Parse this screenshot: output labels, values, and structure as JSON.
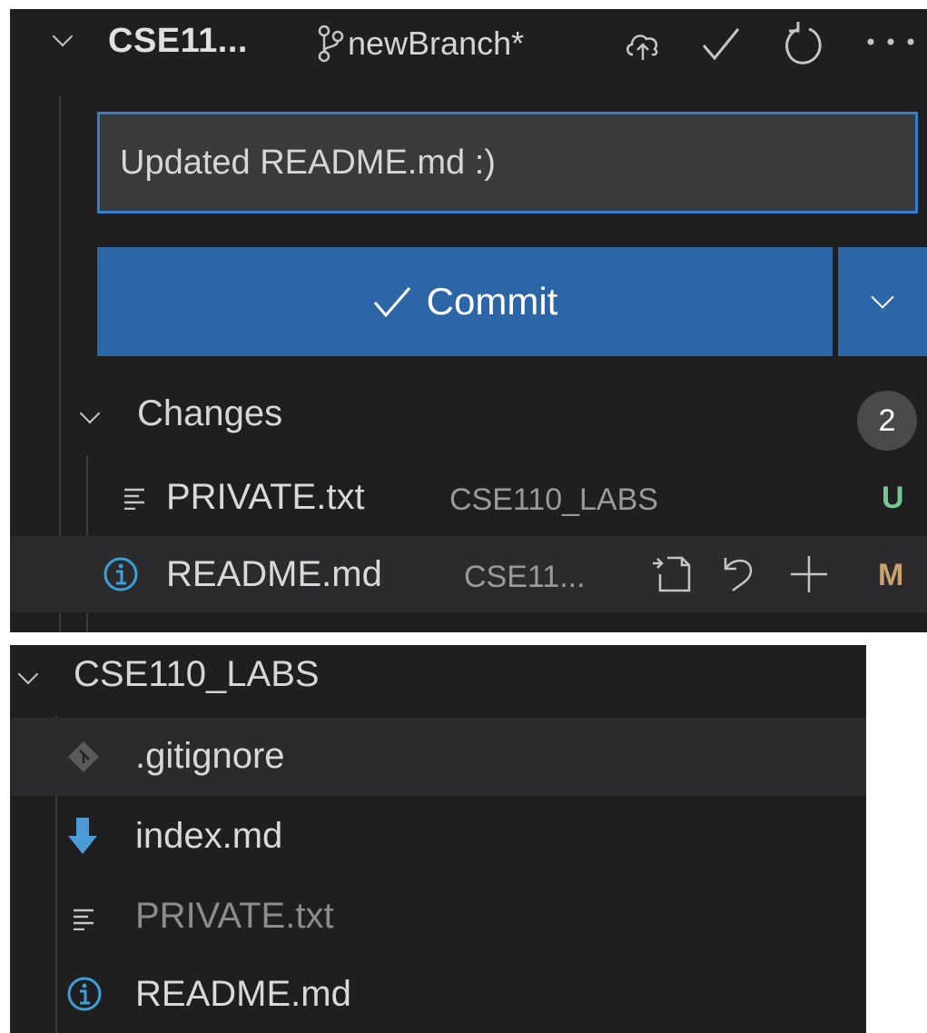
{
  "scm": {
    "repo_name": "CSE11...",
    "branch": "newBranch*",
    "commit_message": "Updated README.md :)",
    "commit_label": "Commit",
    "changes_label": "Changes",
    "changes_count": "2",
    "changes": [
      {
        "name": "PRIVATE.txt",
        "dir": "CSE110_LABS",
        "status": "U",
        "status_color": "#73c991",
        "icon": "lines-icon"
      },
      {
        "name": "README.md",
        "dir": "CSE11...",
        "status": "M",
        "status_color": "#c9a26d",
        "icon": "info-icon"
      }
    ]
  },
  "explorer": {
    "title": "CSE110_LABS",
    "files": [
      {
        "name": ".gitignore",
        "icon": "git-icon"
      },
      {
        "name": "index.md",
        "icon": "download-arrow-icon"
      },
      {
        "name": "PRIVATE.txt",
        "icon": "lines-icon"
      },
      {
        "name": "README.md",
        "icon": "info-icon"
      }
    ]
  },
  "colors": {
    "panel_bg": "#1f1f1f",
    "accent_blue": "#2c66a6",
    "input_border": "#2f7fd3",
    "untracked_green": "#73c991",
    "modified_tan": "#c9a26d",
    "info_blue": "#3c9fd8"
  }
}
